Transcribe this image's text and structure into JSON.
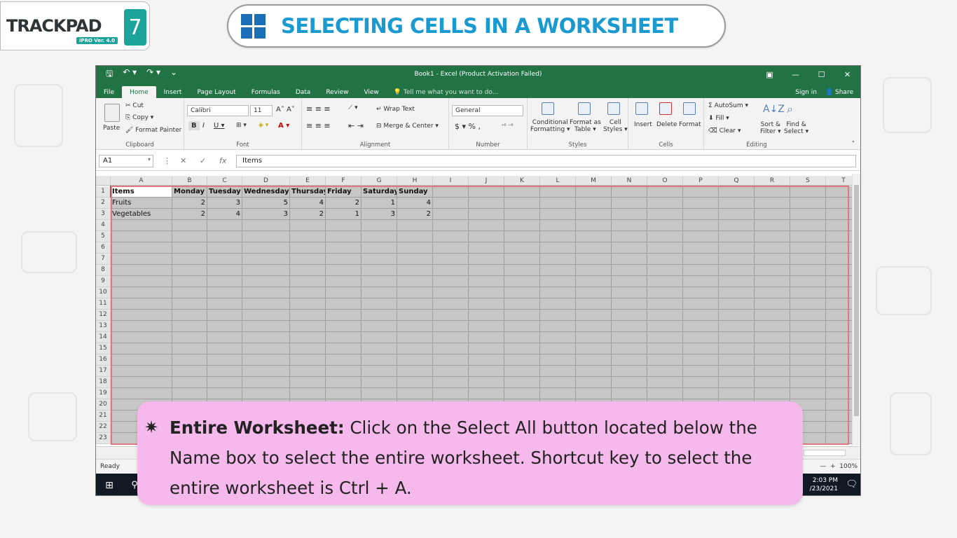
{
  "brand": {
    "name": "TRACKPAD",
    "version": "iPRO Ver. 4.0",
    "number": "7"
  },
  "banner": {
    "title": "SELECTING CELLS IN A WORKSHEET"
  },
  "excel": {
    "title": "Book1 - Excel (Product Activation Failed)",
    "tabs": [
      "File",
      "Home",
      "Insert",
      "Page Layout",
      "Formulas",
      "Data",
      "Review",
      "View"
    ],
    "tell_me": "Tell me what you want to do...",
    "sign_in": "Sign in",
    "share": "Share",
    "ribbon": {
      "clipboard": {
        "paste": "Paste",
        "cut": "Cut",
        "copy": "Copy",
        "format_painter": "Format Painter",
        "label": "Clipboard"
      },
      "font": {
        "name": "Calibri",
        "size": "11",
        "label": "Font"
      },
      "alignment": {
        "wrap": "Wrap Text",
        "merge": "Merge & Center",
        "label": "Alignment"
      },
      "number": {
        "format": "General",
        "label": "Number"
      },
      "styles": {
        "conditional": "Conditional",
        "formatting": "Formatting",
        "format_as": "Format as",
        "table": "Table",
        "cell": "Cell",
        "cell_styles": "Styles",
        "label": "Styles"
      },
      "cells": {
        "insert": "Insert",
        "delete": "Delete",
        "format": "Format",
        "label": "Cells"
      },
      "editing": {
        "autosum": "AutoSum",
        "fill": "Fill",
        "clear": "Clear",
        "sort": "Sort &",
        "filter": "Filter",
        "find": "Find &",
        "select": "Select",
        "label": "Editing"
      }
    },
    "name_box": "A1",
    "formula": "Items",
    "columns": [
      "A",
      "B",
      "C",
      "D",
      "E",
      "F",
      "G",
      "H",
      "I",
      "J",
      "K",
      "L",
      "M",
      "N",
      "O",
      "P",
      "Q",
      "R",
      "S",
      "T"
    ],
    "header_row": [
      "Items",
      "Monday",
      "Tuesday",
      "Wednesday",
      "Thursday",
      "Friday",
      "Saturday",
      "Sunday"
    ],
    "data_rows": [
      [
        "Fruits",
        "2",
        "3",
        "5",
        "4",
        "2",
        "1",
        "4"
      ],
      [
        "Vegetables",
        "2",
        "4",
        "3",
        "2",
        "1",
        "3",
        "2"
      ]
    ],
    "row_numbers": [
      "1",
      "2",
      "3",
      "4",
      "5",
      "6",
      "7",
      "8",
      "9",
      "10",
      "11",
      "12",
      "13",
      "14",
      "15",
      "16",
      "17",
      "18",
      "19",
      "20",
      "21",
      "22",
      "23"
    ],
    "status": "Ready",
    "zoom": "100%",
    "clock_time": "2:03 PM",
    "clock_date": "/23/2021"
  },
  "callout": {
    "bullet": "✷",
    "heading": "Entire Worksheet:",
    "body": " Click on the Select All button located below the Name box to select the entire worksheet. Shortcut key to select the entire worksheet is Ctrl + A."
  }
}
